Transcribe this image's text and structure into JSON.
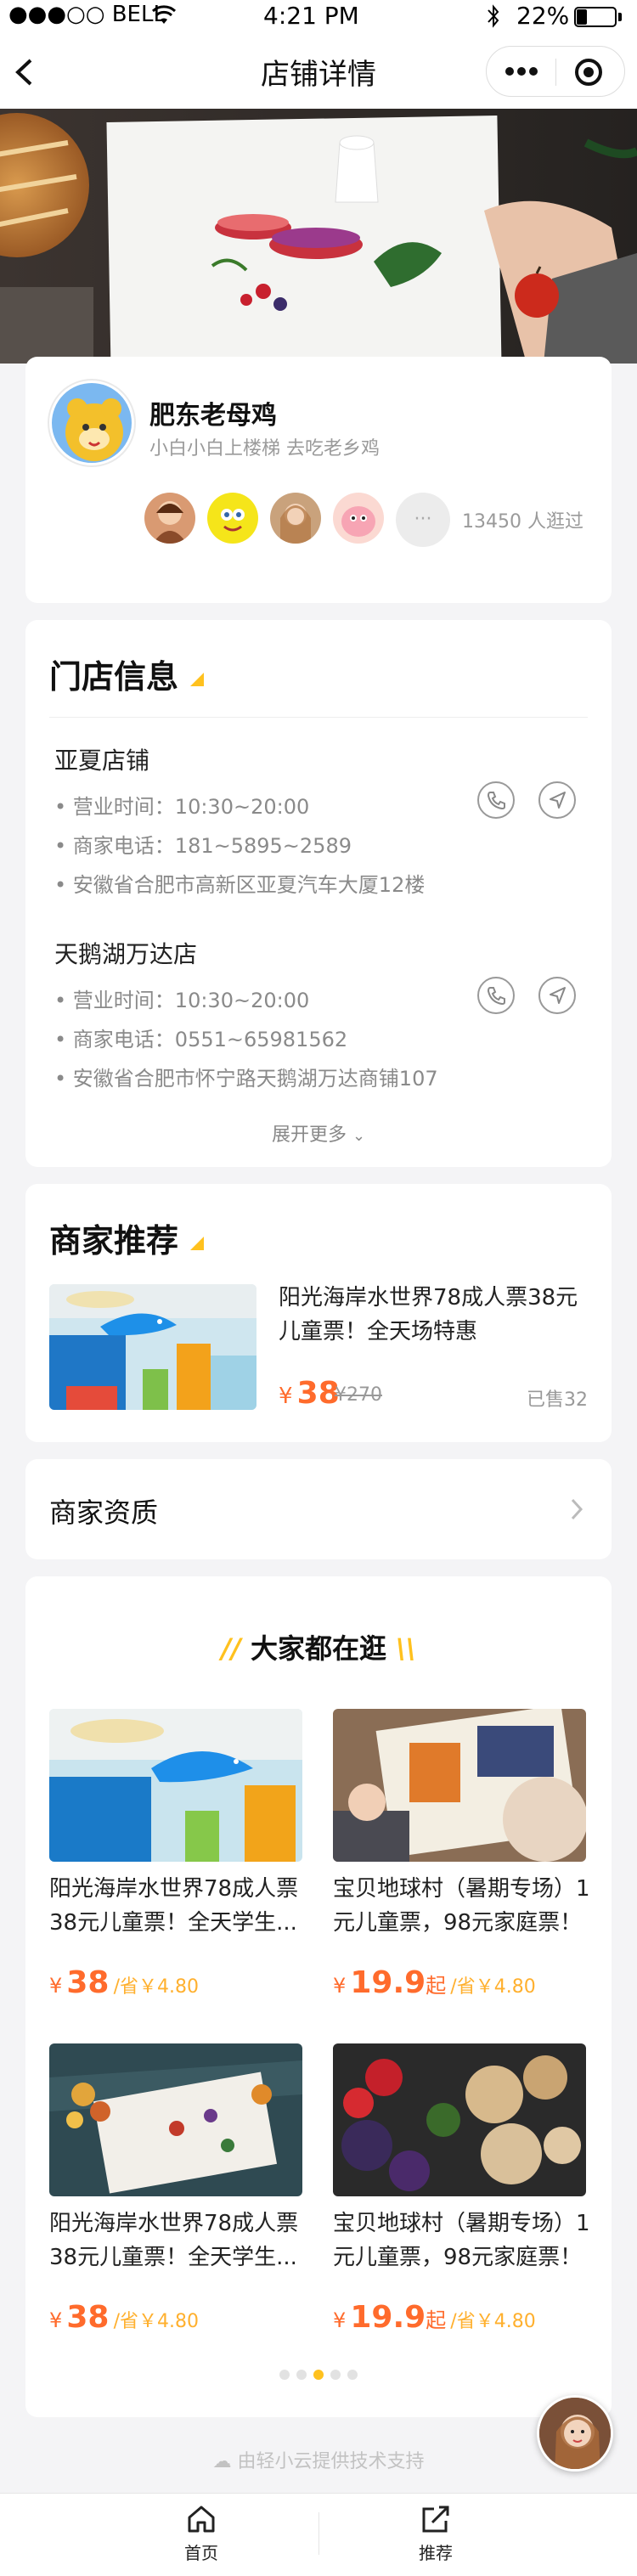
{
  "status_bar": {
    "carrier": "●●●○○ BELL",
    "time": "4:21 PM",
    "battery": "22%"
  },
  "nav": {
    "title": "店铺详情"
  },
  "profile": {
    "name": "肥东老母鸡",
    "subtitle": "小白小白上楼梯 去吃老乡鸡",
    "visitors": "13450 人逛过",
    "more": "···"
  },
  "stores": {
    "title": "门店信息",
    "items": [
      {
        "name": "亚夏店铺",
        "hours": "营业时间：10:30~20:00",
        "phone": "商家电话：181~5895~2589",
        "address": "安徽省合肥市高新区亚夏汽车大厦12楼"
      },
      {
        "name": "天鹅湖万达店",
        "hours": "营业时间：10:30~20:00",
        "phone": "商家电话：0551~65981562",
        "address": "安徽省合肥市怀宁路天鹅湖万达商铺107"
      }
    ],
    "expand": "展开更多"
  },
  "recommend": {
    "title": "商家推荐",
    "product": {
      "title_line1": "阳光海岸水世界78成人票38元",
      "title_line2": "儿童票！全天场特惠",
      "currency": "¥",
      "price": "38",
      "original": "¥270",
      "sold": "已售32"
    }
  },
  "qualification": {
    "label": "商家资质"
  },
  "browse": {
    "title": "大家都在逛",
    "items": [
      {
        "title_line1": "阳光海岸水世界78成人票",
        "title_line2": "38元儿童票！全天学生...",
        "currency": "¥",
        "price": "38",
        "suffix": "",
        "save": "/省￥4.80"
      },
      {
        "title_line1": "宝贝地球村（暑期专场）1",
        "title_line2": "元儿童票，98元家庭票！",
        "currency": "¥",
        "price": "19.9",
        "suffix": "起",
        "save": "/省￥4.80"
      },
      {
        "title_line1": "阳光海岸水世界78成人票",
        "title_line2": "38元儿童票！全天学生...",
        "currency": "¥",
        "price": "38",
        "suffix": "",
        "save": "/省￥4.80"
      },
      {
        "title_line1": "宝贝地球村（暑期专场）1",
        "title_line2": "元儿童票，98元家庭票！",
        "currency": "¥",
        "price": "19.9",
        "suffix": "起",
        "save": "/省￥4.80"
      }
    ],
    "dots_total": 5,
    "dots_active": 2
  },
  "footer": {
    "tech_support": "由轻小云提供技术支持"
  },
  "tabbar": {
    "home": "首页",
    "recommend": "推荐"
  },
  "colors": {
    "accent": "#ffc11e",
    "price": "#ff6b2c",
    "save": "#ffb02e"
  }
}
